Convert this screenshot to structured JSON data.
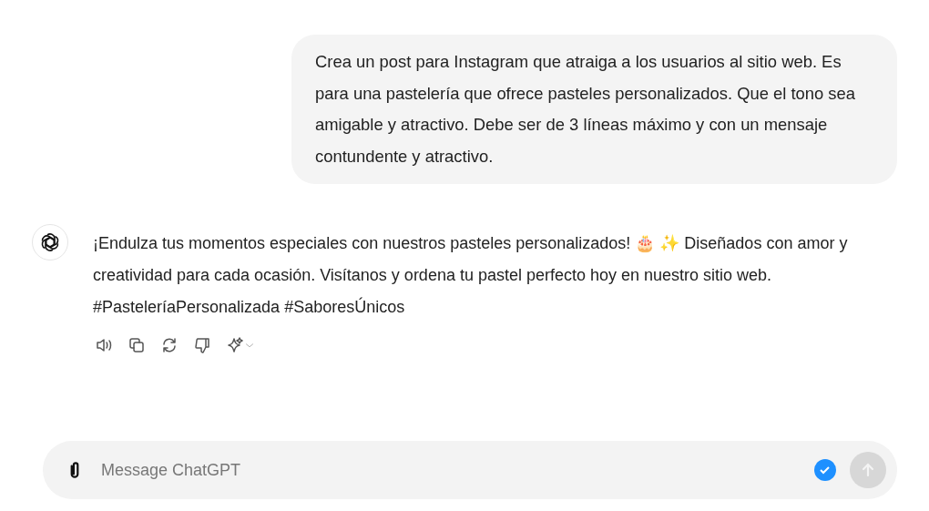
{
  "user_message": {
    "text": "Crea un post para Instagram que atraiga a los usuarios al sitio web. Es para una pastelería que ofrece pasteles personalizados. Que el tono sea amigable y atractivo. Debe ser de 3 líneas máximo y con un mensaje contundente y atractivo."
  },
  "assistant_message": {
    "text": "¡Endulza tus momentos especiales con nuestros pasteles personalizados! 🎂 ✨ Diseñados con amor y creatividad para cada ocasión. Visítanos y ordena tu pastel perfecto hoy en nuestro sitio web. #PasteleríaPersonalizada #SaboresÚnicos",
    "actions": [
      {
        "kind": "speaker"
      },
      {
        "kind": "copy"
      },
      {
        "kind": "regenerate"
      },
      {
        "kind": "dislike"
      },
      {
        "kind": "sparkle"
      }
    ]
  },
  "composer": {
    "placeholder": "Message ChatGPT",
    "send_disabled": true
  }
}
